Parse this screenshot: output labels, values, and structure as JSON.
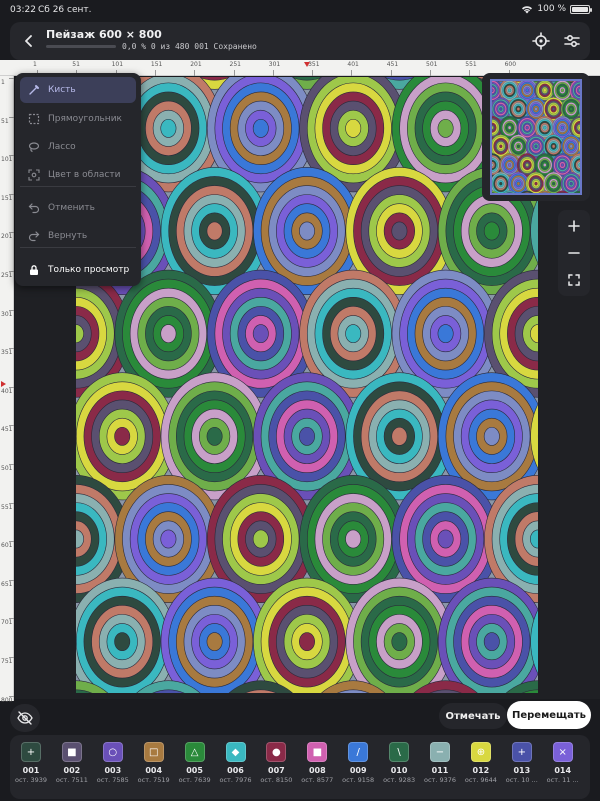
{
  "status": {
    "time": "03:22",
    "date": "Сб 26 сент.",
    "battery": "100 %"
  },
  "header": {
    "title": "Пейзаж 600 × 800",
    "progress_text": "0,0 % 0 из 480 001 Сохранено",
    "progress_fraction": 0.0
  },
  "ruler": {
    "top": [
      "1",
      "51",
      "101",
      "151",
      "201",
      "251",
      "301",
      "351",
      "401",
      "451",
      "501",
      "551",
      "600"
    ],
    "left": [
      "1",
      "51",
      "101",
      "151",
      "201",
      "251",
      "301",
      "351",
      "401",
      "451",
      "501",
      "551",
      "601",
      "651",
      "701",
      "751",
      "800"
    ]
  },
  "tools": [
    {
      "label": "Кисть",
      "icon": "brush-icon",
      "state": "active"
    },
    {
      "label": "Прямоугольник",
      "icon": "rectangle-select-icon",
      "state": "disabled"
    },
    {
      "label": "Лассо",
      "icon": "lasso-icon",
      "state": "disabled"
    },
    {
      "label": "Цвет в области",
      "icon": "color-area-icon",
      "state": "disabled"
    },
    {
      "label": "Отменить",
      "icon": "undo-icon",
      "state": "disabled"
    },
    {
      "label": "Вернуть",
      "icon": "redo-icon",
      "state": "disabled"
    },
    {
      "label": "Только просмотр",
      "icon": "lock-icon",
      "state": "enabled"
    }
  ],
  "actions": {
    "mark": "Отмечать",
    "move": "Перемещать"
  },
  "palette": [
    {
      "num": "001",
      "count": "ост. 3939",
      "color": "#2e4a40",
      "symbol": "+"
    },
    {
      "num": "002",
      "count": "ост. 7511",
      "color": "#5a5070",
      "symbol": "■"
    },
    {
      "num": "003",
      "count": "ост. 7585",
      "color": "#6a50b8",
      "symbol": "○"
    },
    {
      "num": "004",
      "count": "ост. 7519",
      "color": "#a87a40",
      "symbol": "□"
    },
    {
      "num": "005",
      "count": "ост. 7639",
      "color": "#2a8a3a",
      "symbol": "△"
    },
    {
      "num": "006",
      "count": "ост. 7976",
      "color": "#3ab8c0",
      "symbol": "◆"
    },
    {
      "num": "007",
      "count": "ост. 8150",
      "color": "#8a2a48",
      "symbol": "●"
    },
    {
      "num": "008",
      "count": "ост. 8577",
      "color": "#d060b0",
      "symbol": "■"
    },
    {
      "num": "009",
      "count": "ост. 9158",
      "color": "#3a78d8",
      "symbol": "/"
    },
    {
      "num": "010",
      "count": "ост. 9283",
      "color": "#2a6a48",
      "symbol": "\\"
    },
    {
      "num": "011",
      "count": "ост. 9376",
      "color": "#8ab0b0",
      "symbol": "−"
    },
    {
      "num": "012",
      "count": "ост. 9644",
      "color": "#d8d840",
      "symbol": "⊕"
    },
    {
      "num": "013",
      "count": "ост. 10 ...",
      "color": "#4a52a8",
      "symbol": "+"
    },
    {
      "num": "014",
      "count": "ост. 11 ...",
      "color": "#7a60d8",
      "symbol": "×"
    }
  ]
}
